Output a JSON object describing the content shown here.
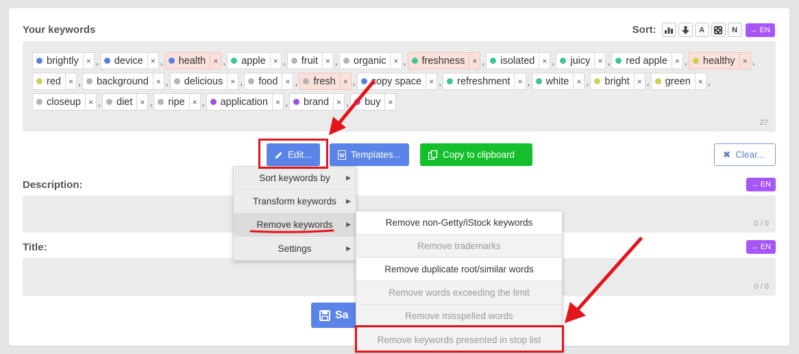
{
  "keywords_section": {
    "title": "Your keywords",
    "sort_label": "Sort:",
    "sort_buttons": [
      {
        "icon": "bar-chart-icon",
        "text": ""
      },
      {
        "icon": "arrow-down-icon",
        "text": ""
      },
      {
        "icon": "alpha-icon",
        "text": "A"
      },
      {
        "icon": "dice-icon",
        "text": ""
      },
      {
        "icon": "n-icon",
        "text": "N"
      }
    ],
    "lang_button": "→ EN",
    "count": "27",
    "rows": [
      [
        {
          "label": "brightly",
          "color": "#5a7fe0",
          "highlight": false
        },
        {
          "label": "device",
          "color": "#5a7fe0",
          "highlight": false
        },
        {
          "label": "health",
          "color": "#5a7fe0",
          "highlight": true
        },
        {
          "label": "apple",
          "color": "#3fc58f",
          "highlight": false
        },
        {
          "label": "fruit",
          "color": "#b4b4b4",
          "highlight": false
        },
        {
          "label": "organic",
          "color": "#b4b4b4",
          "highlight": false
        },
        {
          "label": "freshness",
          "color": "#3fc58f",
          "highlight": true
        },
        {
          "label": "isolated",
          "color": "#3fc58f",
          "highlight": false
        },
        {
          "label": "juicy",
          "color": "#3fc58f",
          "highlight": false
        },
        {
          "label": "red apple",
          "color": "#3fc58f",
          "highlight": false
        },
        {
          "label": "healthy",
          "color": "#cfcf5c",
          "highlight": true
        }
      ],
      [
        {
          "label": "red",
          "color": "#cfcf5c",
          "highlight": false
        },
        {
          "label": "background",
          "color": "#b4b4b4",
          "highlight": false
        },
        {
          "label": "delicious",
          "color": "#b4b4b4",
          "highlight": false
        },
        {
          "label": "food",
          "color": "#b4b4b4",
          "highlight": false
        },
        {
          "label": "fresh",
          "color": "#b4b4b4",
          "highlight": true
        },
        {
          "label": "copy space",
          "color": "#5a7fe0",
          "highlight": false
        },
        {
          "label": "refreshment",
          "color": "#3fc58f",
          "highlight": false
        },
        {
          "label": "white",
          "color": "#3fc58f",
          "highlight": false
        },
        {
          "label": "bright",
          "color": "#cfcf5c",
          "highlight": false
        },
        {
          "label": "green",
          "color": "#cfcf5c",
          "highlight": false
        }
      ],
      [
        {
          "label": "closeup",
          "color": "#b4b4b4",
          "highlight": false
        },
        {
          "label": "diet",
          "color": "#b4b4b4",
          "highlight": false
        },
        {
          "label": "ripe",
          "color": "#b4b4b4",
          "highlight": false
        },
        {
          "label": "application",
          "color": "#a050e0",
          "highlight": false
        },
        {
          "label": "brand",
          "color": "#a050e0",
          "highlight": false
        },
        {
          "label": "buy",
          "color": "#a050e0",
          "highlight": false
        }
      ]
    ]
  },
  "toolbar": {
    "edit": "Edit...",
    "templates": "Templates...",
    "copy": "Copy to clipboard",
    "clear": "Clear..."
  },
  "description": {
    "title": "Description:",
    "counter": "0 / 0",
    "lang_button": "→ EN"
  },
  "title_field": {
    "title": "Title:",
    "counter": "0 / 0",
    "lang_button": "→ EN"
  },
  "save_button": "Sa",
  "edit_menu": {
    "items": [
      "Sort keywords by",
      "Transform keywords",
      "Remove keywords",
      "Settings"
    ]
  },
  "remove_submenu": {
    "items": [
      {
        "label": "Remove non-Getty/iStock keywords",
        "disabled": false
      },
      {
        "label": "Remove trademarks",
        "disabled": true
      },
      {
        "label": "Remove duplicate root/similar words",
        "disabled": false
      },
      {
        "label": "Remove words exceeding the limit",
        "disabled": true
      },
      {
        "label": "Remove misspelled words",
        "disabled": true
      },
      {
        "label": "Remove keywords presented in stop list",
        "disabled": true
      }
    ]
  },
  "colors": {
    "accent": "#5b84e8",
    "purple": "#a855f7",
    "green": "#14bf2b",
    "annotation": "#e3141b"
  }
}
